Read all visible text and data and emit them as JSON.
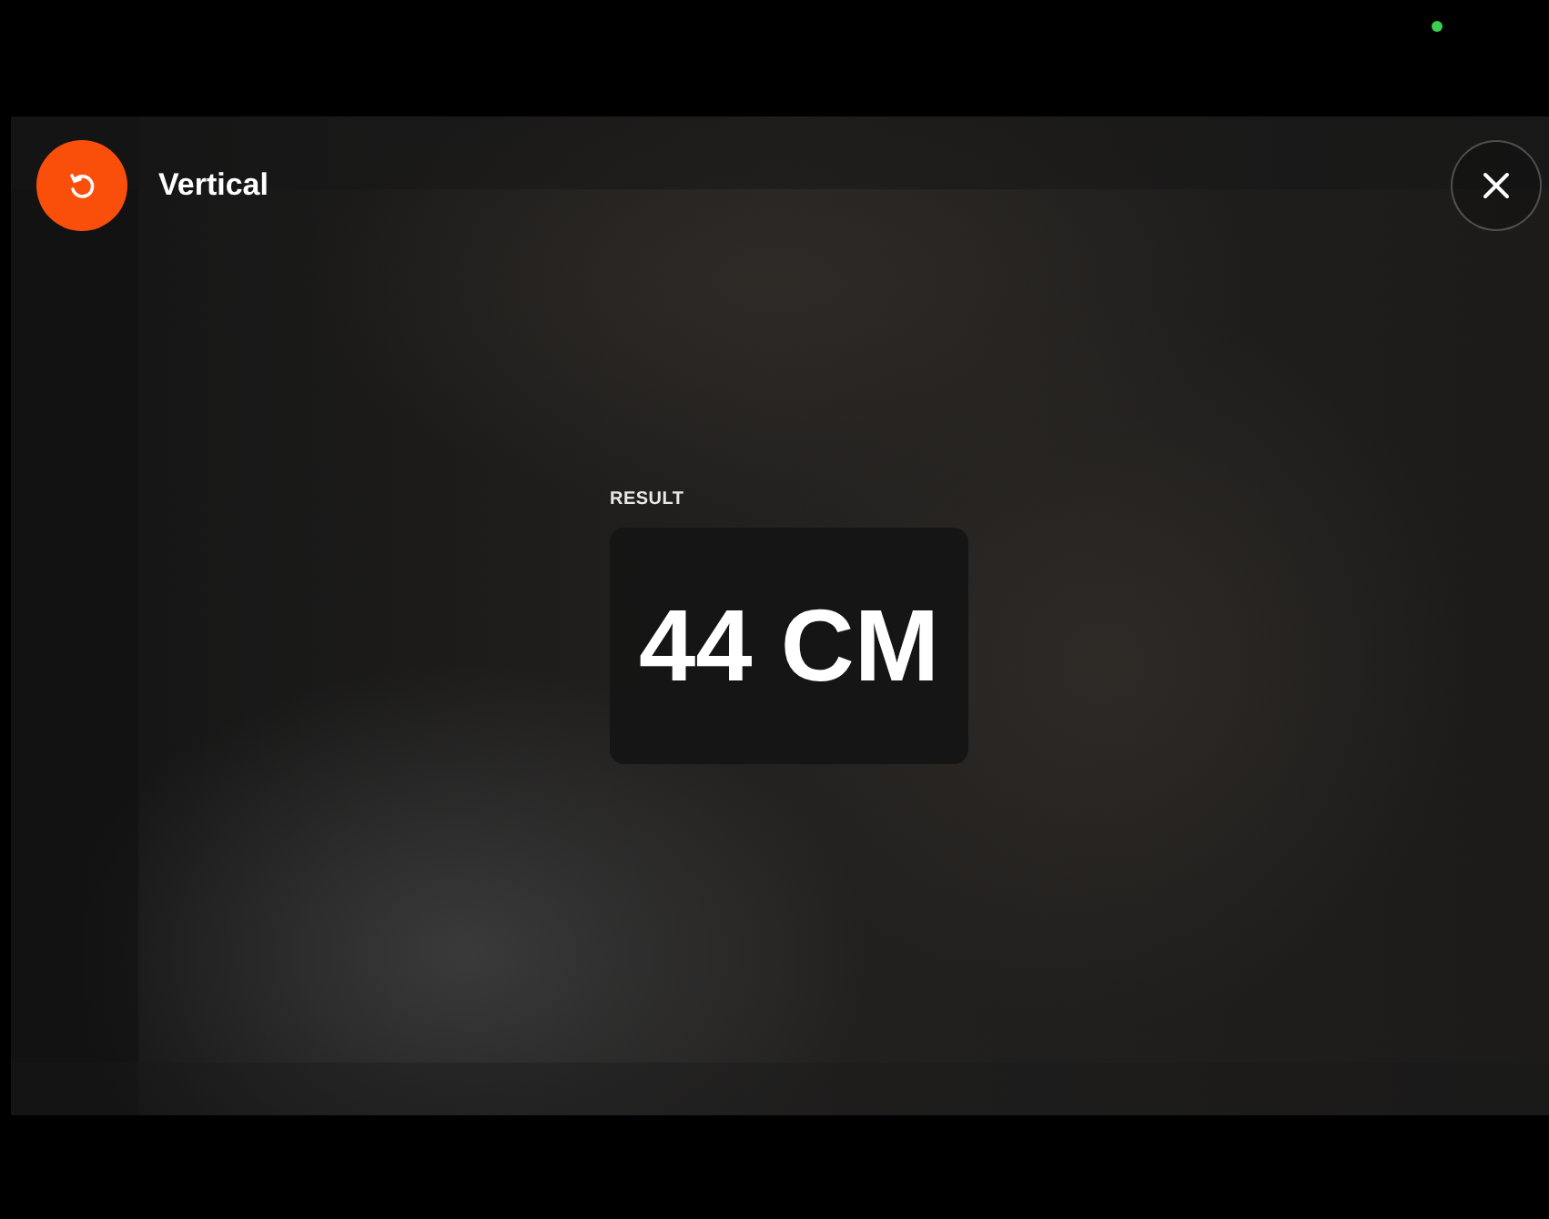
{
  "toolbar": {
    "mode_label": "Vertical"
  },
  "result": {
    "label": "RESULT",
    "value": "44 CM"
  }
}
